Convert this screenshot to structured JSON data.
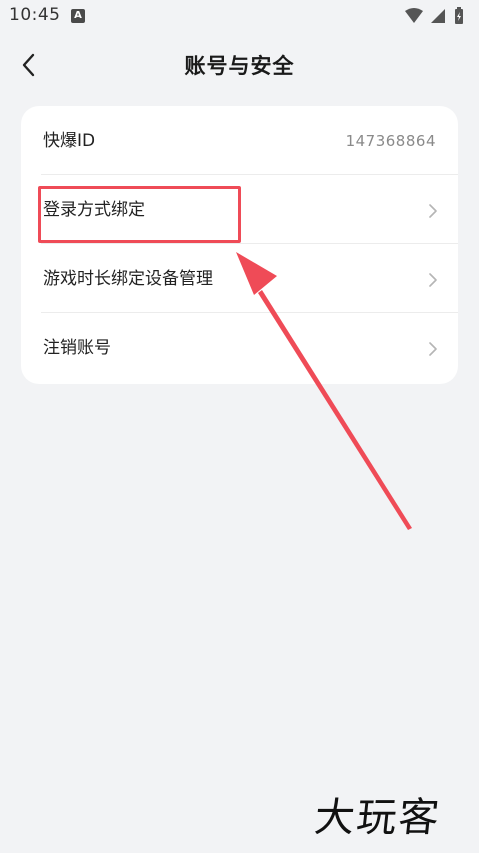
{
  "status_bar": {
    "time": "10:45",
    "app_icon_letter": "A"
  },
  "header": {
    "title": "账号与安全"
  },
  "settings": {
    "items": [
      {
        "label": "快爆ID",
        "value": "147368864"
      },
      {
        "label": "登录方式绑定"
      },
      {
        "label": "游戏时长绑定设备管理"
      },
      {
        "label": "注销账号"
      }
    ]
  },
  "watermark": {
    "text": "大玩客"
  },
  "colors": {
    "background": "#f2f3f5",
    "card": "#ffffff",
    "annotation": "#ef4b57"
  }
}
